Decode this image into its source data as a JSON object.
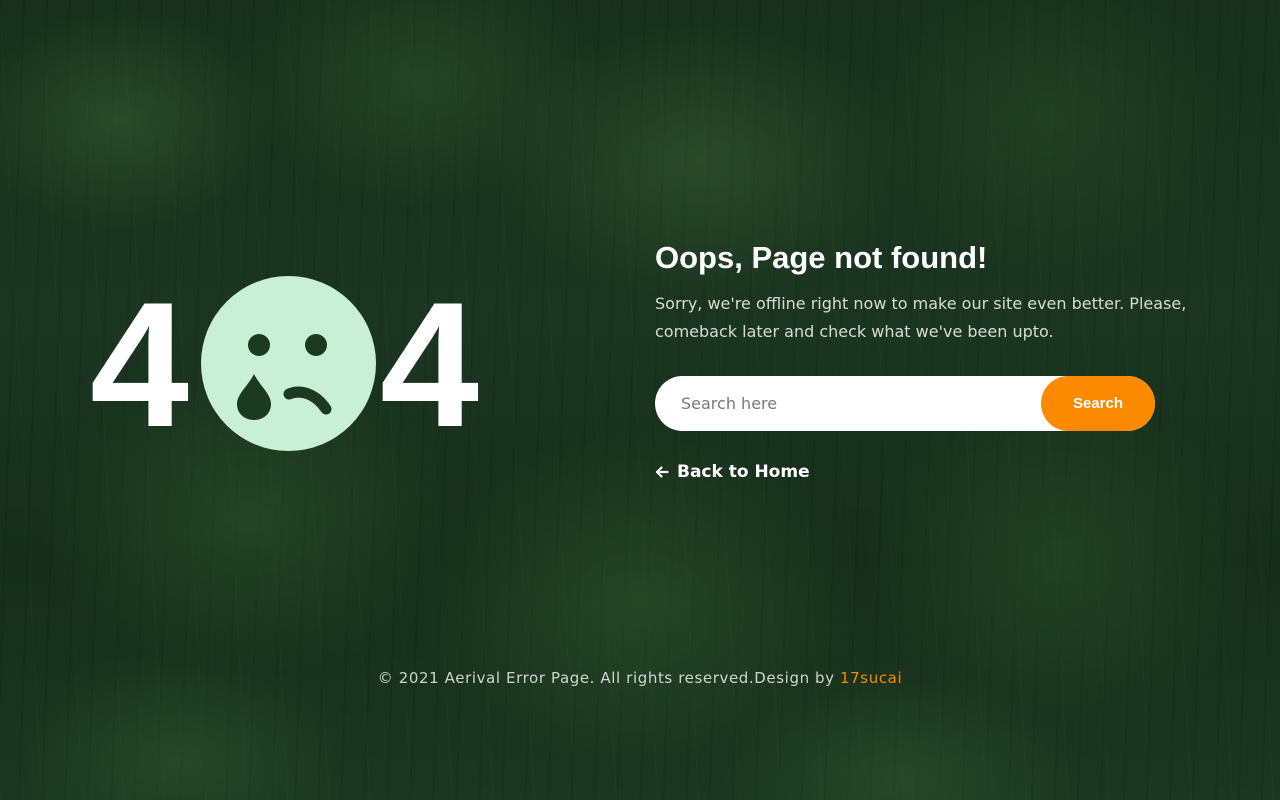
{
  "error": {
    "digit_left": "4",
    "digit_right": "4",
    "face_icon": "crying-face-icon"
  },
  "content": {
    "title": "Oops, Page not found!",
    "message": "Sorry, we're offline right now to make our site even better. Please, comeback later and check what we've been upto."
  },
  "search": {
    "placeholder": "Search here",
    "value": "",
    "button_label": "Search"
  },
  "back_link": {
    "icon": "arrow-left-icon",
    "label": "Back to Home"
  },
  "footer": {
    "copyright": "© 2021 Aerival Error Page. All rights reserved.Design by ",
    "credit_link": "17sucai"
  },
  "colors": {
    "accent": "#fb8a00",
    "face": "#c8f0d6",
    "face_features": "#1b3a20",
    "background": "#1f3d24",
    "text": "#ffffff"
  }
}
